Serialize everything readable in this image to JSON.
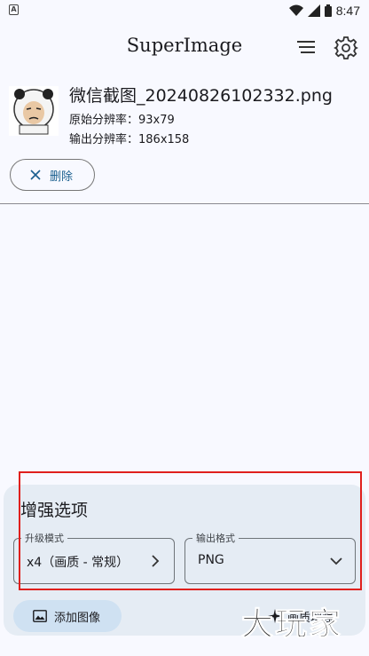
{
  "status_bar": {
    "time": "8:47",
    "notification_icon": "a-letter-icon"
  },
  "app_bar": {
    "title": "SuperImage",
    "menu_icon": "list-icon",
    "settings_icon": "gear-icon"
  },
  "image_item": {
    "file_name": "微信截图_20240826102332.png",
    "original_resolution": "原始分辨率：93x79",
    "output_resolution": "输出分辨率：186x158",
    "delete_label": "删除"
  },
  "enhance_panel": {
    "title": "增强选项",
    "upscale_mode": {
      "label": "升级模式",
      "value": "x4（画质 - 常规）"
    },
    "output_format": {
      "label": "输出格式",
      "value": "PNG"
    },
    "add_image_label": "添加图像",
    "enhance_label": "画质增强"
  },
  "watermark": "大玩家",
  "colors": {
    "accent": "#1a5f8f",
    "panel": "#e5ecf4",
    "add_button": "#cfe1f2",
    "highlight": "#e0201d"
  }
}
